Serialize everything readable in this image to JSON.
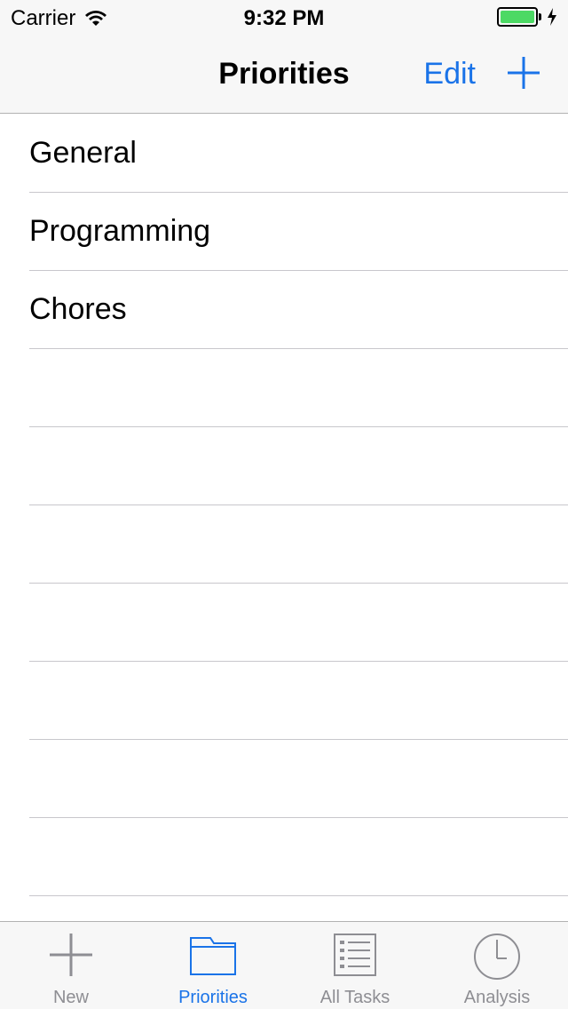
{
  "status_bar": {
    "carrier": "Carrier",
    "time": "9:32 PM",
    "battery_level": 1.0,
    "battery_color": "#4cd964"
  },
  "nav_bar": {
    "title": "Priorities",
    "edit_label": "Edit",
    "add_icon": "plus-icon"
  },
  "table": {
    "rows": [
      "General",
      "Programming",
      "Chores",
      "",
      "",
      "",
      "",
      "",
      "",
      ""
    ]
  },
  "tab_bar": {
    "tabs": [
      {
        "label": "New",
        "icon": "plus-icon",
        "active": false
      },
      {
        "label": "Priorities",
        "icon": "folder-icon",
        "active": true
      },
      {
        "label": "All Tasks",
        "icon": "list-icon",
        "active": false
      },
      {
        "label": "Analysis",
        "icon": "clock-icon",
        "active": false
      }
    ]
  },
  "colors": {
    "accent": "#1a73e8",
    "inactive": "#8e8e93",
    "separator": "#c8c7cc",
    "bar_background": "#f7f7f7"
  }
}
